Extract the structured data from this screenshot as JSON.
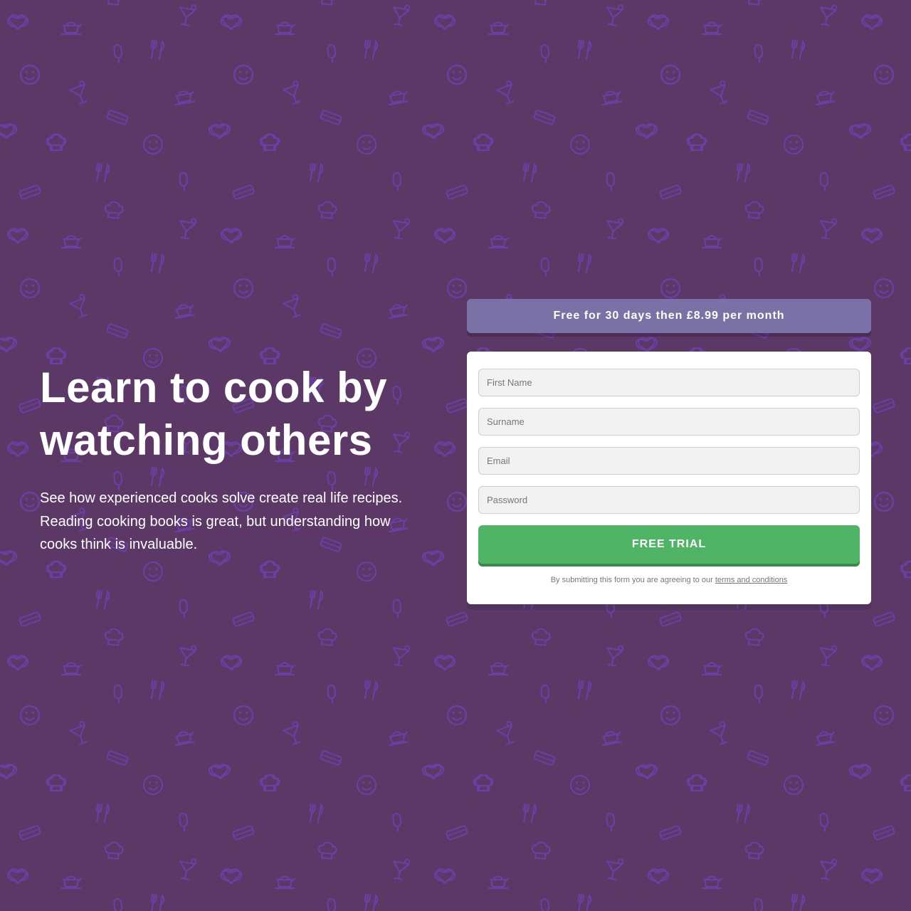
{
  "theme": {
    "background_color": "#5b3866",
    "pattern_color": "#6a3ea3",
    "banner_color": "#7a72a6",
    "cta_color": "#4fb466",
    "cta_shadow_color": "#3a8a4a",
    "card_color": "#ffffff"
  },
  "background": {
    "pattern_icons": [
      "heart-icon",
      "teapot-icon",
      "cocktail-icon",
      "ice-cream-icon",
      "cutlery-icon",
      "smiley-icon",
      "chef-hat-icon",
      "cake-icon"
    ]
  },
  "hero": {
    "title_line1": "Learn to cook by",
    "title_line2": "watching others",
    "description_line1": "See how experienced cooks solve create real life recipes.",
    "description_line2": "Reading cooking books is great, but understanding how",
    "description_line3": "cooks think is invaluable."
  },
  "offer_banner": {
    "text": "Free for 30 days then £8.99 per month"
  },
  "signup_form": {
    "first_name": {
      "placeholder": "First Name",
      "value": ""
    },
    "surname": {
      "placeholder": "Surname",
      "value": ""
    },
    "email": {
      "placeholder": "Email",
      "value": ""
    },
    "password": {
      "placeholder": "Password",
      "value": ""
    },
    "submit_label": "FREE TRIAL",
    "legal_prefix": "By submitting this form you are agreeing to our",
    "legal_link": "terms and conditions"
  }
}
